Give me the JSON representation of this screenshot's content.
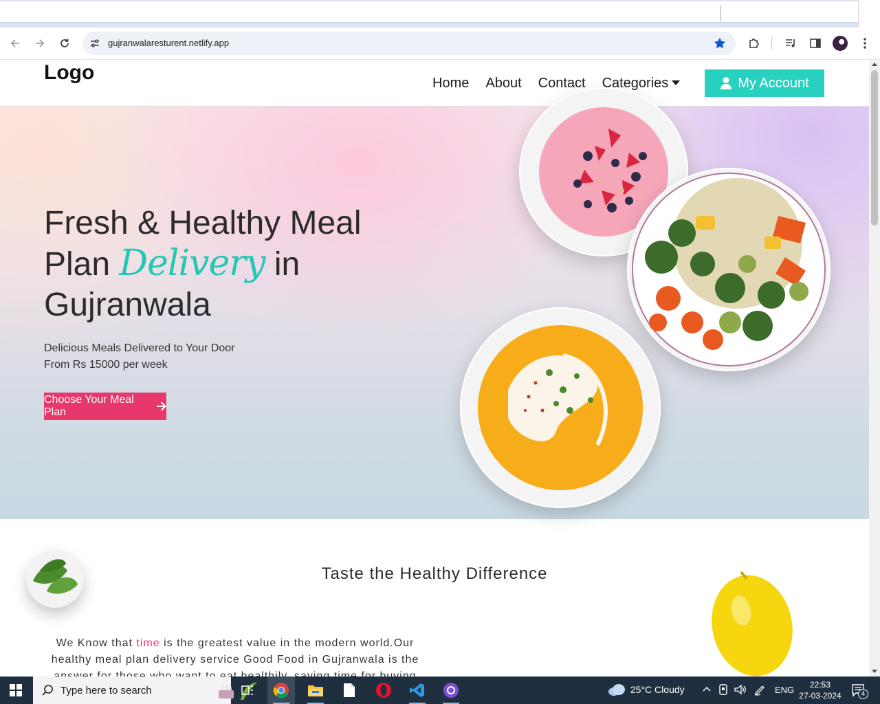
{
  "browser": {
    "url": "gujranwalaresturent.netlify.app"
  },
  "header": {
    "logo": "Logo",
    "nav": [
      "Home",
      "About",
      "Contact",
      "Categories"
    ],
    "account_button": "My Account"
  },
  "hero": {
    "title_line1": "Fresh & Healthy Meal",
    "title_plan": "Plan",
    "title_script": "Delivery",
    "title_in": "in",
    "title_line3": "Gujranwala",
    "subtitle_line1": "Delicious Meals Delivered to Your Door",
    "subtitle_line2": "From Rs 15000 per week",
    "cta": "Choose Your Meal Plan"
  },
  "section": {
    "title": "Taste the Healthy Difference",
    "text_before": "We Know that ",
    "text_accent": "time",
    "text_after": " is the greatest value in the modern world.Our healthy meal plan delivery service Good Food in Gujranwala is the answer for those who want to eat healthily, saving time for buying"
  },
  "taskbar": {
    "search_placeholder": "Type here to search",
    "weather": "25°C  Cloudy",
    "language": "ENG",
    "time": "22:53",
    "date": "27-03-2024",
    "notifications": "4"
  },
  "colors": {
    "accent_teal": "#28d1bf",
    "accent_pink": "#e8386b"
  }
}
